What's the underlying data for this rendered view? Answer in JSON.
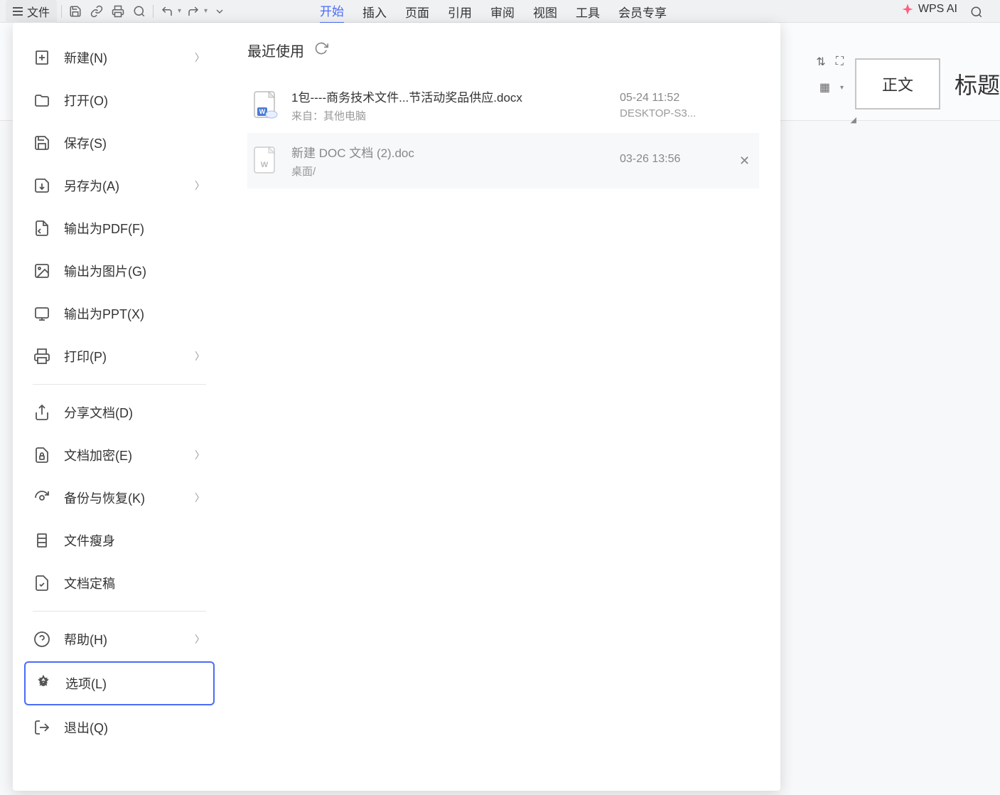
{
  "toolbar": {
    "file_label": "文件"
  },
  "tabs": {
    "start": "开始",
    "insert": "插入",
    "page": "页面",
    "reference": "引用",
    "review": "审阅",
    "view": "视图",
    "tools": "工具",
    "member": "会员专享"
  },
  "wps_ai_label": "WPS AI",
  "ribbon": {
    "style_normal": "正文",
    "style_heading": "标题"
  },
  "sidebar": {
    "new": "新建(N)",
    "open": "打开(O)",
    "save": "保存(S)",
    "saveas": "另存为(A)",
    "export_pdf": "输出为PDF(F)",
    "export_image": "输出为图片(G)",
    "export_ppt": "输出为PPT(X)",
    "print": "打印(P)",
    "share": "分享文档(D)",
    "encrypt": "文档加密(E)",
    "backup": "备份与恢复(K)",
    "slim": "文件瘦身",
    "finalize": "文档定稿",
    "help": "帮助(H)",
    "options": "选项(L)",
    "exit": "退出(Q)"
  },
  "content": {
    "recent_title": "最近使用",
    "files": [
      {
        "name": "1包----商务技术文件...节活动奖品供应.docx",
        "source": "来自：其他电脑",
        "date": "05-24 11:52",
        "device": "DESKTOP-S3...",
        "type": "docx-cloud"
      },
      {
        "name": "新建 DOC 文档 (2).doc",
        "source": "桌面/",
        "date": "03-26 13:56",
        "device": "",
        "type": "doc"
      }
    ]
  }
}
